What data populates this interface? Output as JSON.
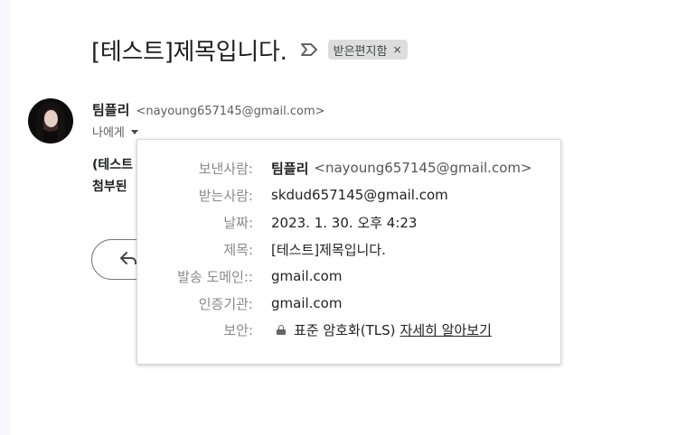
{
  "subject": "[테스트]제목입니다.",
  "label_chip": {
    "text": "받은편지함",
    "close": "×"
  },
  "sender": {
    "name": "팀플리",
    "email": "<nayoung657145@gmail.com>"
  },
  "recipient_summary": "나에게",
  "body": {
    "line1": "(테스트",
    "line2": "첨부된"
  },
  "details": {
    "from_label": "보낸사람:",
    "from_name": "팀플리",
    "from_email": "<nayoung657145@gmail.com>",
    "to_label": "받는사람:",
    "to_value": "skdud657145@gmail.com",
    "date_label": "날짜:",
    "date_value": "2023. 1. 30. 오후 4:23",
    "subject_label": "제목:",
    "subject_value": "[테스트]제목입니다.",
    "mailed_by_label": "발송 도메인::",
    "mailed_by_value": "gmail.com",
    "signed_by_label": "인증기관:",
    "signed_by_value": "gmail.com",
    "security_label": "보안:",
    "security_value": "표준 암호화(TLS)",
    "security_link": "자세히 알아보기"
  },
  "icons": {
    "important": "important-marker-icon",
    "caret": "caret-down-icon",
    "reply": "reply-icon",
    "lock": "lock-icon"
  },
  "colors": {
    "chip_bg": "#dddddd",
    "side_strip": "#f6f8fc"
  }
}
